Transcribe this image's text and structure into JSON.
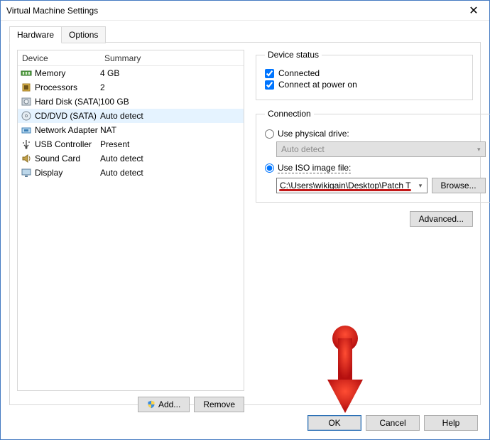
{
  "window": {
    "title": "Virtual Machine Settings"
  },
  "tabs": {
    "hardware": "Hardware",
    "options": "Options"
  },
  "list": {
    "header_device": "Device",
    "header_summary": "Summary",
    "rows": [
      {
        "name": "Memory",
        "summary": "4 GB"
      },
      {
        "name": "Processors",
        "summary": "2"
      },
      {
        "name": "Hard Disk (SATA)",
        "summary": "100 GB"
      },
      {
        "name": "CD/DVD (SATA)",
        "summary": "Auto detect"
      },
      {
        "name": "Network Adapter",
        "summary": "NAT"
      },
      {
        "name": "USB Controller",
        "summary": "Present"
      },
      {
        "name": "Sound Card",
        "summary": "Auto detect"
      },
      {
        "name": "Display",
        "summary": "Auto detect"
      }
    ]
  },
  "left_buttons": {
    "add": "Add...",
    "remove": "Remove"
  },
  "status": {
    "title": "Device status",
    "connected": "Connected",
    "connect_power_on": "Connect at power on"
  },
  "connection": {
    "title": "Connection",
    "physical": "Use physical drive:",
    "physical_value": "Auto detect",
    "iso_label": "Use ISO image file:",
    "iso_value": "C:\\Users\\wikigain\\Desktop\\Patch T",
    "browse": "Browse..."
  },
  "advanced": "Advanced...",
  "dialog": {
    "ok": "OK",
    "cancel": "Cancel",
    "help": "Help"
  }
}
